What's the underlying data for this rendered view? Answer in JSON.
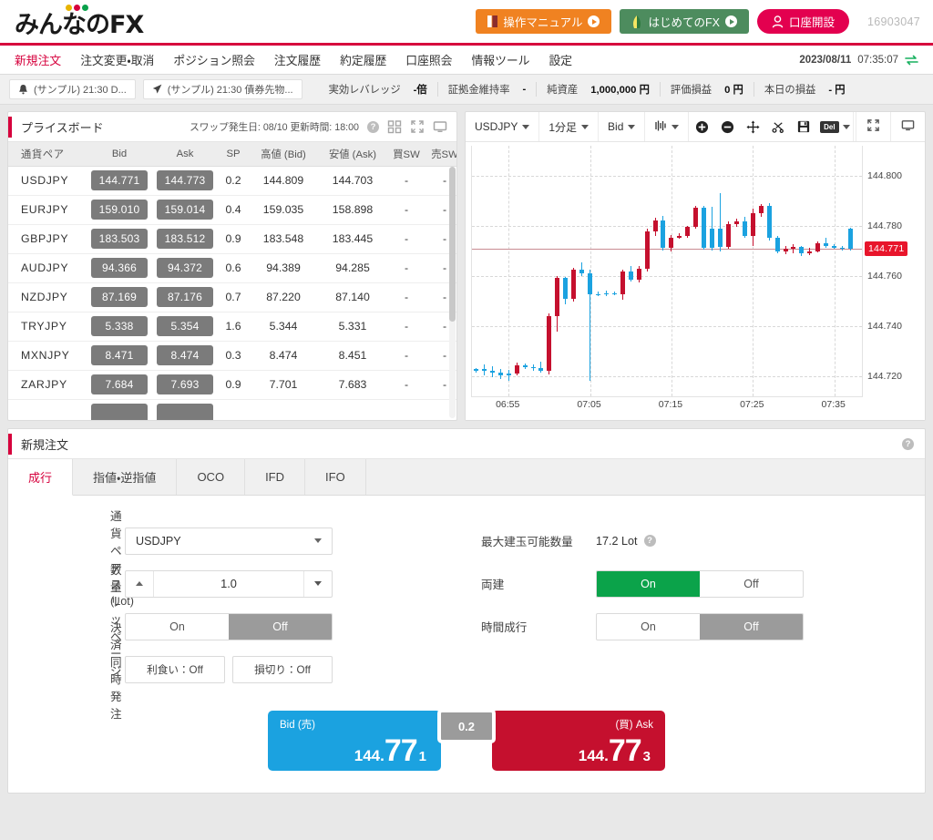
{
  "header": {
    "logo_text": "みんなのFX",
    "logo_dot_colors": [
      "#e8b400",
      "#d6003c",
      "#0aa14b"
    ],
    "buttons": [
      {
        "label": "操作マニュアル",
        "icon": "book-icon",
        "color": "#f08221"
      },
      {
        "label": "はじめてのFX",
        "icon": "leaf-icon",
        "color": "#4d8c5e"
      },
      {
        "label": "口座開設",
        "icon": "person-icon",
        "color": "#e3004f"
      }
    ],
    "account_number": "16903047",
    "accent_color": "#d6003c"
  },
  "nav": {
    "items": [
      {
        "label": "新規注文",
        "active": true
      },
      {
        "label": "注文変更・取消",
        "active": false
      },
      {
        "label": "ポジション照会",
        "active": false
      },
      {
        "label": "注文履歴",
        "active": false
      },
      {
        "label": "約定履歴",
        "active": false
      },
      {
        "label": "口座照会",
        "active": false
      },
      {
        "label": "情報ツール",
        "active": false
      },
      {
        "label": "設定",
        "active": false
      }
    ],
    "date": "2023/08/11",
    "time": "07:35:07",
    "sync_icon": "sync-arrows-icon"
  },
  "infobar": {
    "news": [
      {
        "icon": "bell-icon",
        "text": "(サンプル) 21:30 D..."
      },
      {
        "icon": "rocket-icon",
        "text": "(サンプル) 21:30 債券先物..."
      }
    ],
    "stats": [
      {
        "label": "実効レバレッジ",
        "value": "-倍"
      },
      {
        "label": "証拠金維持率",
        "value": "-"
      },
      {
        "label": "純資産",
        "value": "1,000,000 円"
      },
      {
        "label": "評価損益",
        "value": "0 円"
      },
      {
        "label": "本日の損益",
        "value": "- 円"
      }
    ]
  },
  "priceboard": {
    "title": "プライスボード",
    "meta": "スワップ発生日: 08/10 更新時間: 18:00",
    "help_icon": "help-icon",
    "icons": [
      "grid-view-icon",
      "expand-icon",
      "monitor-icon"
    ],
    "columns": [
      "通貨ペア",
      "Bid",
      "Ask",
      "SP",
      "高値 (Bid)",
      "安値 (Ask)",
      "買SW",
      "売SW"
    ],
    "rows": [
      {
        "pair": "USDJPY",
        "bid": "144.771",
        "ask": "144.773",
        "sp": "0.2",
        "high": "144.809",
        "low": "144.703",
        "buy_sw": "-",
        "sell_sw": "-"
      },
      {
        "pair": "EURJPY",
        "bid": "159.010",
        "ask": "159.014",
        "sp": "0.4",
        "high": "159.035",
        "low": "158.898",
        "buy_sw": "-",
        "sell_sw": "-"
      },
      {
        "pair": "GBPJPY",
        "bid": "183.503",
        "ask": "183.512",
        "sp": "0.9",
        "high": "183.548",
        "low": "183.445",
        "buy_sw": "-",
        "sell_sw": "-"
      },
      {
        "pair": "AUDJPY",
        "bid": "94.366",
        "ask": "94.372",
        "sp": "0.6",
        "high": "94.389",
        "low": "94.285",
        "buy_sw": "-",
        "sell_sw": "-"
      },
      {
        "pair": "NZDJPY",
        "bid": "87.169",
        "ask": "87.176",
        "sp": "0.7",
        "high": "87.220",
        "low": "87.140",
        "buy_sw": "-",
        "sell_sw": "-"
      },
      {
        "pair": "TRYJPY",
        "bid": "5.338",
        "ask": "5.354",
        "sp": "1.6",
        "high": "5.344",
        "low": "5.331",
        "buy_sw": "-",
        "sell_sw": "-"
      },
      {
        "pair": "MXNJPY",
        "bid": "8.471",
        "ask": "8.474",
        "sp": "0.3",
        "high": "8.474",
        "low": "8.451",
        "buy_sw": "-",
        "sell_sw": "-"
      },
      {
        "pair": "ZARJPY",
        "bid": "7.684",
        "ask": "7.693",
        "sp": "0.9",
        "high": "7.701",
        "low": "7.683",
        "buy_sw": "-",
        "sell_sw": "-"
      }
    ]
  },
  "chart": {
    "toolbar": {
      "symbol": "USDJPY",
      "timeframe": "1分足",
      "price_type": "Bid",
      "indicator_icon": "indicator-icon",
      "zoom_in_icon": "zoom-in-icon",
      "zoom_out_icon": "zoom-out-icon",
      "move_icon": "move-crosshair-icon",
      "scissors_icon": "scissors-icon",
      "save_icon": "save-icon",
      "delete_label": "Del",
      "expand_icon": "expand-icon",
      "monitor_icon": "monitor-icon"
    },
    "chart_data": {
      "type": "line",
      "title": "USDJPY 1分足 Bid",
      "xlabel": "",
      "ylabel": "",
      "grid": true,
      "ylim": [
        144.71,
        144.812
      ],
      "yticks": [
        "144.800",
        "144.780",
        "144.760",
        "144.740",
        "144.720"
      ],
      "ytick_values": [
        144.8,
        144.78,
        144.76,
        144.74,
        144.72
      ],
      "xticks": [
        "06:55",
        "07:05",
        "07:15",
        "07:25",
        "07:35"
      ],
      "current_price": "144.771",
      "current_price_value": 144.771,
      "candles": [
        {
          "o": 144.7225,
          "h": 144.7235,
          "l": 144.7215,
          "c": 144.723,
          "dir": "down"
        },
        {
          "o": 144.723,
          "h": 144.725,
          "l": 144.7205,
          "c": 144.7222,
          "dir": "down"
        },
        {
          "o": 144.7222,
          "h": 144.724,
          "l": 144.7198,
          "c": 144.7215,
          "dir": "down"
        },
        {
          "o": 144.7215,
          "h": 144.723,
          "l": 144.719,
          "c": 144.7205,
          "dir": "down"
        },
        {
          "o": 144.7205,
          "h": 144.7228,
          "l": 144.7185,
          "c": 144.7212,
          "dir": "down"
        },
        {
          "o": 144.7212,
          "h": 144.7255,
          "l": 144.7205,
          "c": 144.7245,
          "dir": "up"
        },
        {
          "o": 144.7245,
          "h": 144.7252,
          "l": 144.723,
          "c": 144.7238,
          "dir": "down"
        },
        {
          "o": 144.7238,
          "h": 144.7248,
          "l": 144.7225,
          "c": 144.7235,
          "dir": "down"
        },
        {
          "o": 144.7235,
          "h": 144.726,
          "l": 144.7215,
          "c": 144.7222,
          "dir": "down"
        },
        {
          "o": 144.7225,
          "h": 144.7452,
          "l": 144.721,
          "c": 144.744,
          "dir": "up"
        },
        {
          "o": 144.744,
          "h": 144.76,
          "l": 144.738,
          "c": 144.7592,
          "dir": "up"
        },
        {
          "o": 144.7592,
          "h": 144.7598,
          "l": 144.749,
          "c": 144.751,
          "dir": "down"
        },
        {
          "o": 144.751,
          "h": 144.7635,
          "l": 144.75,
          "c": 144.7628,
          "dir": "up"
        },
        {
          "o": 144.7628,
          "h": 144.7655,
          "l": 144.76,
          "c": 144.7612,
          "dir": "down"
        },
        {
          "o": 144.7612,
          "h": 144.7625,
          "l": 144.7185,
          "c": 144.7528,
          "dir": "down"
        },
        {
          "o": 144.7528,
          "h": 144.754,
          "l": 144.752,
          "c": 144.753,
          "dir": "down"
        },
        {
          "o": 144.753,
          "h": 144.7542,
          "l": 144.7522,
          "c": 144.7532,
          "dir": "down"
        },
        {
          "o": 144.7532,
          "h": 144.754,
          "l": 144.7525,
          "c": 144.753,
          "dir": "down"
        },
        {
          "o": 144.753,
          "h": 144.7628,
          "l": 144.7505,
          "c": 144.762,
          "dir": "up"
        },
        {
          "o": 144.762,
          "h": 144.764,
          "l": 144.7578,
          "c": 144.7588,
          "dir": "down"
        },
        {
          "o": 144.7588,
          "h": 144.764,
          "l": 144.7575,
          "c": 144.763,
          "dir": "up"
        },
        {
          "o": 144.763,
          "h": 144.779,
          "l": 144.7618,
          "c": 144.7778,
          "dir": "up"
        },
        {
          "o": 144.7778,
          "h": 144.7832,
          "l": 144.776,
          "c": 144.7822,
          "dir": "up"
        },
        {
          "o": 144.7822,
          "h": 144.784,
          "l": 144.7702,
          "c": 144.7712,
          "dir": "down"
        },
        {
          "o": 144.7712,
          "h": 144.7765,
          "l": 144.77,
          "c": 144.7752,
          "dir": "up"
        },
        {
          "o": 144.7752,
          "h": 144.7772,
          "l": 144.7748,
          "c": 144.776,
          "dir": "up"
        },
        {
          "o": 144.776,
          "h": 144.7802,
          "l": 144.7755,
          "c": 144.7798,
          "dir": "up"
        },
        {
          "o": 144.7798,
          "h": 144.788,
          "l": 144.779,
          "c": 144.7872,
          "dir": "up"
        },
        {
          "o": 144.7872,
          "h": 144.7882,
          "l": 144.7705,
          "c": 144.7712,
          "dir": "down"
        },
        {
          "o": 144.7712,
          "h": 144.7875,
          "l": 144.7702,
          "c": 144.779,
          "dir": "down"
        },
        {
          "o": 144.779,
          "h": 144.7932,
          "l": 144.77,
          "c": 144.7718,
          "dir": "down"
        },
        {
          "o": 144.7718,
          "h": 144.782,
          "l": 144.771,
          "c": 144.7808,
          "dir": "up"
        },
        {
          "o": 144.7808,
          "h": 144.7828,
          "l": 144.7798,
          "c": 144.7818,
          "dir": "up"
        },
        {
          "o": 144.7818,
          "h": 144.7838,
          "l": 144.7752,
          "c": 144.7762,
          "dir": "down"
        },
        {
          "o": 144.7762,
          "h": 144.7868,
          "l": 144.772,
          "c": 144.7852,
          "dir": "up"
        },
        {
          "o": 144.7852,
          "h": 144.7888,
          "l": 144.7838,
          "c": 144.788,
          "dir": "up"
        },
        {
          "o": 144.788,
          "h": 144.7892,
          "l": 144.7742,
          "c": 144.7752,
          "dir": "down"
        },
        {
          "o": 144.7752,
          "h": 144.7762,
          "l": 144.769,
          "c": 144.77,
          "dir": "down"
        },
        {
          "o": 144.77,
          "h": 144.7722,
          "l": 144.7688,
          "c": 144.771,
          "dir": "up"
        },
        {
          "o": 144.771,
          "h": 144.7728,
          "l": 144.7692,
          "c": 144.7718,
          "dir": "up"
        },
        {
          "o": 144.7718,
          "h": 144.7722,
          "l": 144.7682,
          "c": 144.769,
          "dir": "down"
        },
        {
          "o": 144.769,
          "h": 144.7712,
          "l": 144.7685,
          "c": 144.77,
          "dir": "up"
        },
        {
          "o": 144.77,
          "h": 144.7738,
          "l": 144.7695,
          "c": 144.773,
          "dir": "up"
        },
        {
          "o": 144.773,
          "h": 144.7752,
          "l": 144.7712,
          "c": 144.7722,
          "dir": "down"
        },
        {
          "o": 144.7722,
          "h": 144.7728,
          "l": 144.7708,
          "c": 144.7714,
          "dir": "down"
        },
        {
          "o": 144.7714,
          "h": 144.7722,
          "l": 144.7702,
          "c": 144.771,
          "dir": "down"
        },
        {
          "o": 144.7788,
          "h": 144.7792,
          "l": 144.7702,
          "c": 144.771,
          "dir": "down"
        }
      ],
      "colors": {
        "up": "#c5102e",
        "down": "#1ba2e0",
        "current_line": "#c98b92"
      }
    }
  },
  "order": {
    "title": "新規注文",
    "help_icon": "help-icon",
    "tabs": [
      {
        "label": "成行",
        "active": true
      },
      {
        "label": "指値・逆指値",
        "active": false
      },
      {
        "label": "OCO",
        "active": false
      },
      {
        "label": "IFD",
        "active": false
      },
      {
        "label": "IFO",
        "active": false
      }
    ],
    "fields": {
      "pair_label": "通貨ペア",
      "pair_value": "USDJPY",
      "qty_label": "数量 (Lot)",
      "qty_value": "1.0",
      "slippage_label": "スリッページ",
      "slippage_on": "On",
      "slippage_off": "Off",
      "slippage_selected": "Off",
      "close_order_label": "決済同時発注",
      "take_profit": "利食い：Off",
      "stop_loss": "損切り：Off",
      "max_lot_label": "最大建玉可能数量",
      "max_lot_value": "17.2 Lot",
      "hedge_label": "両建",
      "hedge_on": "On",
      "hedge_off": "Off",
      "hedge_selected": "On",
      "time_order_label": "時間成行",
      "time_on": "On",
      "time_off": "Off",
      "time_selected": "Off"
    },
    "deal": {
      "bid_label": "Bid (売)",
      "bid_int": "144.",
      "bid_big": "77",
      "bid_small": "1",
      "spread": "0.2",
      "ask_label": "(買) Ask",
      "ask_int": "144.",
      "ask_big": "77",
      "ask_small": "3",
      "bid_color": "#1ba2e0",
      "ask_color": "#c5102e"
    }
  }
}
